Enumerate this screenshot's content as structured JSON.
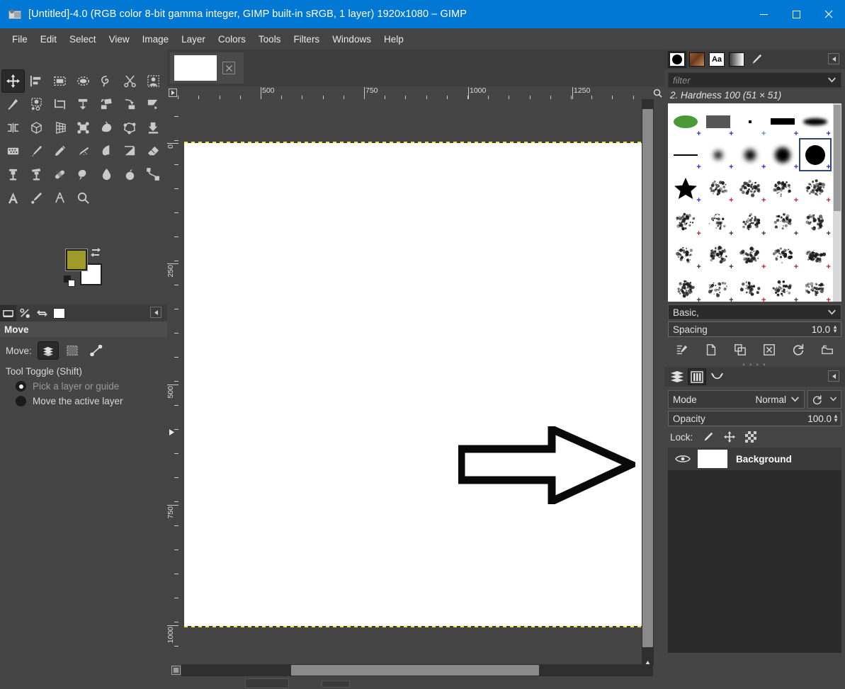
{
  "window": {
    "title": "[Untitled]-4.0 (RGB color 8-bit gamma integer, GIMP built-in sRGB, 1 layer) 1920x1080 – GIMP",
    "app_icon": "gimp-wilber-icon",
    "minimize_label": "minimize-icon",
    "maximize_label": "maximize-icon",
    "close_label": "close-icon",
    "titlebar_color": "#0078d4"
  },
  "menubar": {
    "items": [
      {
        "label": "File"
      },
      {
        "label": "Edit"
      },
      {
        "label": "Select"
      },
      {
        "label": "View"
      },
      {
        "label": "Image"
      },
      {
        "label": "Layer"
      },
      {
        "label": "Colors"
      },
      {
        "label": "Tools"
      },
      {
        "label": "Filters"
      },
      {
        "label": "Windows"
      },
      {
        "label": "Help"
      }
    ]
  },
  "toolbox": {
    "tools": [
      {
        "name": "move-tool",
        "icon": "move-icon",
        "active": true
      },
      {
        "name": "alignment-tool",
        "icon": "align-icon",
        "active": false
      },
      {
        "name": "rectangle-select-tool",
        "icon": "rect-select-icon",
        "active": false
      },
      {
        "name": "ellipse-select-tool",
        "icon": "ellipse-select-icon",
        "active": false
      },
      {
        "name": "free-select-tool",
        "icon": "lasso-icon",
        "active": false
      },
      {
        "name": "scissors-select-tool",
        "icon": "scissors-icon",
        "active": false
      },
      {
        "name": "foreground-select-tool",
        "icon": "foreground-select-icon",
        "active": false
      },
      {
        "name": "fuzzy-select-tool",
        "icon": "magic-wand-icon",
        "active": false
      },
      {
        "name": "select-by-color-tool",
        "icon": "select-by-color-icon",
        "active": false
      },
      {
        "name": "crop-tool",
        "icon": "crop-icon",
        "active": false
      },
      {
        "name": "transform-tool",
        "icon": "unified-transform-icon",
        "active": false
      },
      {
        "name": "warp-transform-tool",
        "icon": "warp-icon",
        "active": false
      },
      {
        "name": "rotate-tool",
        "icon": "rotate-icon",
        "active": false
      },
      {
        "name": "shear-tool",
        "icon": "shear-icon",
        "active": false
      },
      {
        "name": "flip-tool",
        "icon": "flip-icon",
        "active": false
      },
      {
        "name": "3d-transform-tool",
        "icon": "cube-icon",
        "active": false
      },
      {
        "name": "perspective-tool",
        "icon": "perspective-grid-icon",
        "active": false
      },
      {
        "name": "handle-transform-tool",
        "icon": "handle-transform-icon",
        "active": false
      },
      {
        "name": "bucket-fill-tool",
        "icon": "bucket-fill-icon",
        "active": false
      },
      {
        "name": "cage-transform-tool",
        "icon": "cage-icon",
        "active": false
      },
      {
        "name": "gradient-tool",
        "icon": "gradient-icon",
        "active": false
      },
      {
        "name": "dither-tool",
        "icon": "dither-icon",
        "active": false
      },
      {
        "name": "paintbrush-tool",
        "icon": "paintbrush-icon",
        "active": false
      },
      {
        "name": "pencil-tool",
        "icon": "pencil-icon",
        "active": false
      },
      {
        "name": "airbrush-tool",
        "icon": "airbrush-icon",
        "active": false
      },
      {
        "name": "ink-tool",
        "icon": "ink-pen-icon",
        "active": false
      },
      {
        "name": "mypaint-brush-tool",
        "icon": "mypaint-brush-icon",
        "active": false
      },
      {
        "name": "eraser-tool",
        "icon": "eraser-icon",
        "active": false
      },
      {
        "name": "clone-tool",
        "icon": "clone-stamp-icon",
        "active": false
      },
      {
        "name": "perspective-clone-tool",
        "icon": "perspective-clone-icon",
        "active": false
      },
      {
        "name": "heal-tool",
        "icon": "bandage-heal-icon",
        "active": false
      },
      {
        "name": "smudge-tool",
        "icon": "smudge-icon",
        "active": false
      },
      {
        "name": "blur-sharpen-tool",
        "icon": "water-drop-icon",
        "active": false
      },
      {
        "name": "dodge-burn-tool",
        "icon": "dodge-burn-icon",
        "active": false
      },
      {
        "name": "paths-tool",
        "icon": "paths-icon",
        "active": false
      },
      {
        "name": "text-tool",
        "icon": "text-a-icon",
        "active": false
      },
      {
        "name": "color-picker-tool",
        "icon": "color-picker-icon",
        "active": false
      },
      {
        "name": "measure-tool",
        "icon": "measure-compass-icon",
        "active": false
      },
      {
        "name": "zoom-tool",
        "icon": "magnifier-icon",
        "active": false
      }
    ],
    "colors": {
      "foreground": "#a09a2a",
      "background": "#ffffff",
      "swap_icon": "swap-colors-icon",
      "reset_icon": "reset-colors-icon"
    }
  },
  "tool_options": {
    "tabs": [
      {
        "name": "tool-options-tab",
        "icon": "tool-options-icon",
        "active": true
      },
      {
        "name": "device-status-tab",
        "icon": "device-status-icon",
        "active": false
      },
      {
        "name": "undo-history-tab",
        "icon": "undo-history-icon",
        "active": false
      },
      {
        "name": "images-tab",
        "icon": "images-icon",
        "active": false
      }
    ],
    "menu_icon": "panel-menu-icon",
    "title": "Move",
    "move_label": "Move:",
    "move_modes": [
      {
        "name": "move-layer-mode",
        "icon": "layers-icon",
        "active": true
      },
      {
        "name": "move-selection-mode",
        "icon": "selection-icon",
        "active": false
      },
      {
        "name": "move-path-mode",
        "icon": "path-icon",
        "active": false
      }
    ],
    "tool_toggle_label": "Tool Toggle  (Shift)",
    "radios": [
      {
        "label": "Pick a layer or guide",
        "selected": true
      },
      {
        "label": "Move the active layer",
        "selected": false
      }
    ]
  },
  "image_window": {
    "tab": {
      "name": "image-tab",
      "close_icon": "close-tab-icon"
    },
    "h_ruler": {
      "labels": [
        "500",
        "750",
        "1000",
        "1250"
      ],
      "label_positions": [
        118,
        264,
        411,
        558
      ],
      "unit": "px"
    },
    "v_ruler": {
      "labels": [
        "0",
        "250",
        "500",
        "750",
        "1000"
      ],
      "label_positions": [
        62,
        232,
        403,
        573,
        743
      ]
    },
    "canvas": {
      "background": "#ffffff",
      "layer_boundary_color": "#f2e84a",
      "content": "black-outline-arrow-pointing-right"
    },
    "scrollbars": {
      "vertical_name": "canvas-vertical-scrollbar",
      "horizontal_name": "canvas-horizontal-scrollbar"
    },
    "nav_icons": {
      "top_left": "ruler-menu-icon",
      "top_right": "zoom-image-icon",
      "bottom_left": "quick-mask-icon",
      "bottom_right": "navigation-icon"
    }
  },
  "brushes_panel": {
    "tabs": [
      {
        "name": "brushes-tab",
        "icon": "brush-circle-icon",
        "active": true
      },
      {
        "name": "patterns-tab",
        "icon": "pattern-icon",
        "active": false
      },
      {
        "name": "fonts-tab",
        "icon": "fonts-aa-icon",
        "active": false
      },
      {
        "name": "gradients-tab",
        "icon": "gradient-swatch-icon",
        "active": false
      },
      {
        "name": "paint-dynamics-tab",
        "icon": "paintbrush-icon",
        "active": false
      }
    ],
    "menu_icon": "panel-menu-icon",
    "filter_placeholder": "filter",
    "filter_value": "",
    "filter_dropdown_icon": "chevron-down-icon",
    "selected_brush": "2. Hardness 100 (51 × 51)",
    "tag_filter": "Basic,",
    "tag_dropdown_icon": "chevron-down-icon",
    "spacing_label": "Spacing",
    "spacing_value": "10.0",
    "buttons": [
      {
        "name": "edit-brush-button",
        "icon": "edit-brush-icon"
      },
      {
        "name": "new-brush-button",
        "icon": "new-brush-icon"
      },
      {
        "name": "duplicate-brush-button",
        "icon": "duplicate-brush-icon"
      },
      {
        "name": "delete-brush-button",
        "icon": "delete-brush-icon"
      },
      {
        "name": "refresh-brushes-button",
        "icon": "refresh-icon"
      },
      {
        "name": "open-brush-folder-button",
        "icon": "open-folder-icon"
      }
    ]
  },
  "layers_panel": {
    "tabs": [
      {
        "name": "layers-tab",
        "icon": "layers-stack-icon",
        "active": false
      },
      {
        "name": "channels-tab",
        "icon": "channels-icon",
        "active": true
      },
      {
        "name": "paths-tab",
        "icon": "paths-icon",
        "active": false
      }
    ],
    "menu_icon": "panel-menu-icon",
    "mode_label": "Mode",
    "mode_value": "Normal",
    "mode_dropdown_icon": "chevron-down-icon",
    "mode_reset_icon": "reset-mode-icon",
    "opacity_label": "Opacity",
    "opacity_value": "100.0",
    "lock_label": "Lock:",
    "lock_icons": [
      {
        "name": "lock-pixels-icon"
      },
      {
        "name": "lock-position-icon"
      },
      {
        "name": "lock-alpha-icon"
      }
    ],
    "layers": [
      {
        "name": "Background",
        "visible": true,
        "visibility_icon": "eye-icon"
      }
    ]
  }
}
